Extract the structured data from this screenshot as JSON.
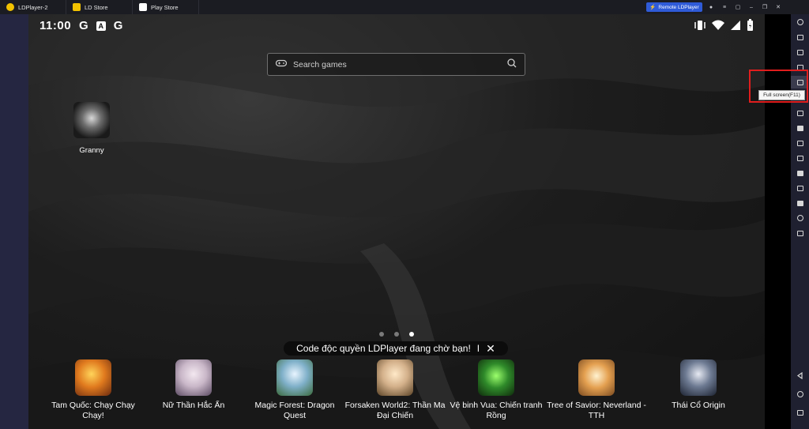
{
  "titlebar": {
    "tabs": [
      {
        "label": "LDPlayer-2"
      },
      {
        "label": "LD Store"
      },
      {
        "label": "Play Store"
      }
    ],
    "remote_label": "Remote LDPlayer",
    "window_controls": [
      "user-icon",
      "menu-icon",
      "settings-icon",
      "minimize-icon",
      "restore-icon",
      "close-icon"
    ]
  },
  "status_bar": {
    "time": "11:00",
    "left_icons": [
      "G",
      "A",
      "G"
    ],
    "right_icons": [
      "vibrate-icon",
      "wifi-icon",
      "signal-icon",
      "battery-icon"
    ]
  },
  "search": {
    "placeholder": "Search games"
  },
  "desktop_app": {
    "label": "Granny"
  },
  "page_dots": {
    "count": 3,
    "active": 2
  },
  "promo": {
    "text": "Code độc quyền LDPlayer đang chờ bạn!",
    "separator": "I",
    "close": "✕"
  },
  "dock_apps": [
    {
      "label": "Tam Quốc: Chạy Chạy Chạy!",
      "color": "#e07a1e"
    },
    {
      "label": "Nữ Thần Hắc Ẩn",
      "color": "#c9b7c8"
    },
    {
      "label": "Magic Forest: Dragon Quest",
      "color": "#7fb0c9"
    },
    {
      "label": "Forsaken World2: Thần Ma Đại Chiến",
      "color": "#d3b08a"
    },
    {
      "label": "Vệ binh Vua: Chiến tranh Rồng",
      "color": "#2f8a2a"
    },
    {
      "label": "Tree of Savior: Neverland -TTH",
      "color": "#e4a050"
    },
    {
      "label": "Thái Cổ Origin",
      "color": "#6d7a92"
    }
  ],
  "toolbar": {
    "tooltip": "Full screen(F11)"
  },
  "colors": {
    "accent": "#2f5bd8",
    "highlight": "#e01d1d"
  }
}
